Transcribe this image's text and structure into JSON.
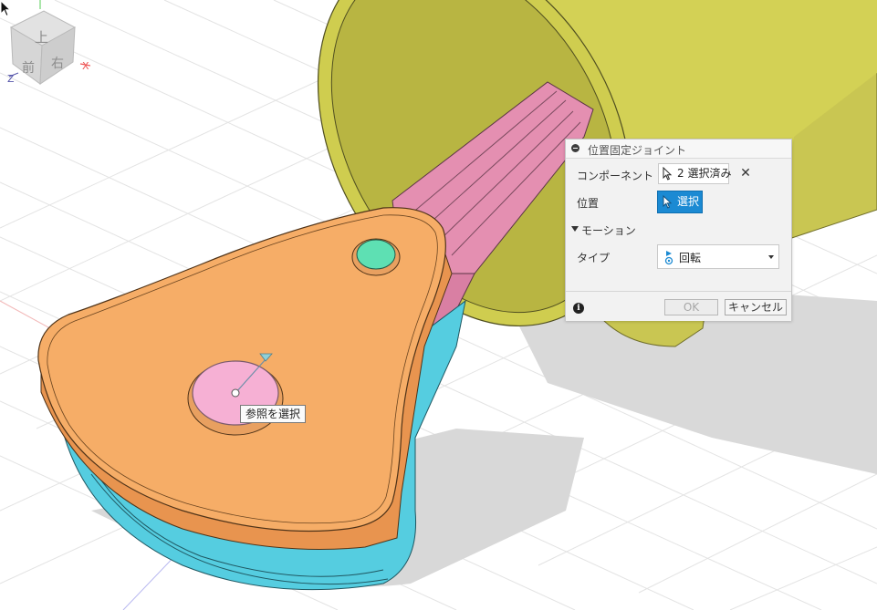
{
  "tooltip": {
    "text": "参照を選択"
  },
  "dialog": {
    "title": "位置固定ジョイント",
    "component_label": "コンポーネント",
    "component_value": "2 選択済み",
    "position_label": "位置",
    "position_button": "選択",
    "motion_section": "モーション",
    "type_label": "タイプ",
    "type_value": "回転",
    "ok": "OK",
    "cancel": "キャンセル"
  },
  "viewcube": {
    "top": "上",
    "front": "前",
    "right": "右",
    "axis_x": "X",
    "axis_z": "Z"
  },
  "colors": {
    "yellow_part": "#d3d155",
    "pink_part": "#e48fb1",
    "orange_part": "#f6ad67",
    "cyan_part": "#55cde0",
    "green_pin": "#5ee0b3",
    "pink_face": "#f6b0d4",
    "accent": "#1b8ad3"
  }
}
